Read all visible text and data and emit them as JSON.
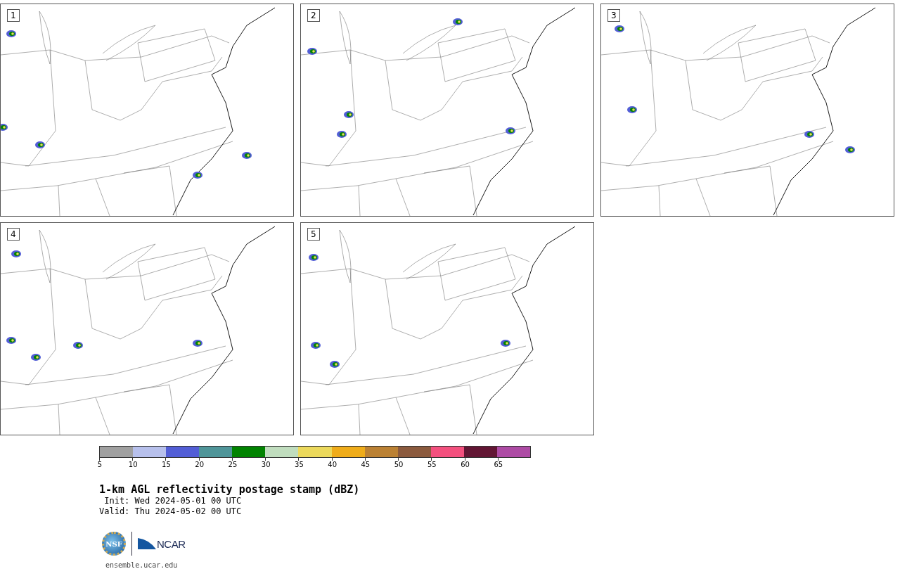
{
  "panels": [
    {
      "label": "1"
    },
    {
      "label": "2"
    },
    {
      "label": "3"
    },
    {
      "label": "4"
    },
    {
      "label": "5"
    }
  ],
  "colorbar": {
    "segments": [
      {
        "color": "#a0a0a0"
      },
      {
        "color": "#b7c0ec"
      },
      {
        "color": "#525ed6"
      },
      {
        "color": "#4f9599"
      },
      {
        "color": "#018301"
      },
      {
        "color": "#c0ddbe"
      },
      {
        "color": "#ecd95c"
      },
      {
        "color": "#efac1a"
      },
      {
        "color": "#bb8134"
      },
      {
        "color": "#8b5a3e"
      },
      {
        "color": "#f3507e"
      },
      {
        "color": "#621634"
      },
      {
        "color": "#ad4ba4"
      }
    ],
    "ticks": [
      "5",
      "10",
      "15",
      "20",
      "25",
      "30",
      "35",
      "40",
      "45",
      "50",
      "55",
      "60",
      "65"
    ]
  },
  "title": "1-km AGL reflectivity postage stamp (dBZ)",
  "init": " Init: Wed 2024-05-01 00 UTC",
  "valid": "Valid: Thu 2024-05-02 00 UTC",
  "logos": {
    "seal_text": "NSF",
    "wordmark": "NCAR"
  },
  "url": "ensemble.ucar.edu"
}
